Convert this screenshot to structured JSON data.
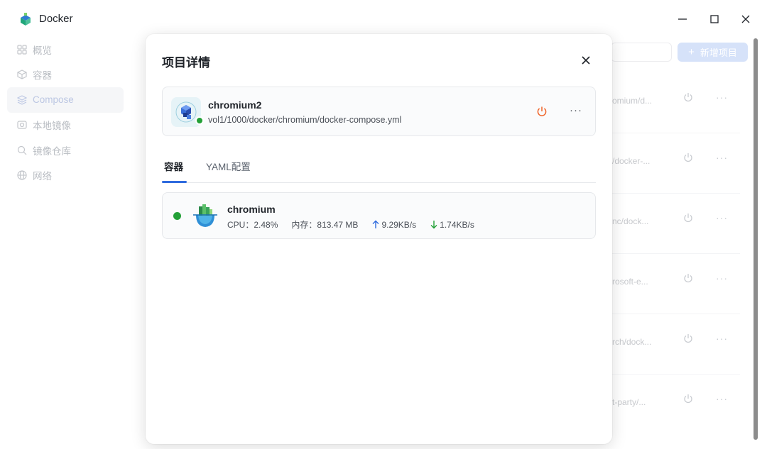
{
  "window": {
    "title": "Docker",
    "controls": {
      "minimize": "minimize-icon",
      "maximize": "maximize-icon",
      "close": "close-icon"
    }
  },
  "sidebar": {
    "items": [
      {
        "label": "概览",
        "icon": "grid-icon"
      },
      {
        "label": "容器",
        "icon": "box-icon"
      },
      {
        "label": "Compose",
        "icon": "layers-icon",
        "active": true
      },
      {
        "label": "本地镜像",
        "icon": "image-icon"
      },
      {
        "label": "镜像仓库",
        "icon": "search-icon"
      },
      {
        "label": "网络",
        "icon": "globe-icon"
      }
    ]
  },
  "background_list": {
    "new_button_label": "新增项目",
    "rows": [
      {
        "path": "omium/d..."
      },
      {
        "path": "/docker-..."
      },
      {
        "path": "nc/dock..."
      },
      {
        "path": "rosoft-e..."
      },
      {
        "path": "rch/dock..."
      },
      {
        "path": "t-party/..."
      }
    ]
  },
  "modal": {
    "title": "项目详情",
    "project": {
      "name": "chromium2",
      "path": "vol1/1000/docker/chromium/docker-compose.yml",
      "status_color": "#23a037"
    },
    "tabs": [
      {
        "label": "容器",
        "active": true
      },
      {
        "label": "YAML配置",
        "active": false
      }
    ],
    "containers": [
      {
        "name": "chromium",
        "cpu_label": "CPU：",
        "cpu_value": "2.48%",
        "mem_label": "内存：",
        "mem_value": "813.47 MB",
        "upload": "9.29KB/s",
        "download": "1.74KB/s",
        "status_color": "#23a037"
      }
    ]
  },
  "colors": {
    "accent": "#2f6bde",
    "running": "#23a037",
    "power": "#f0652a"
  }
}
